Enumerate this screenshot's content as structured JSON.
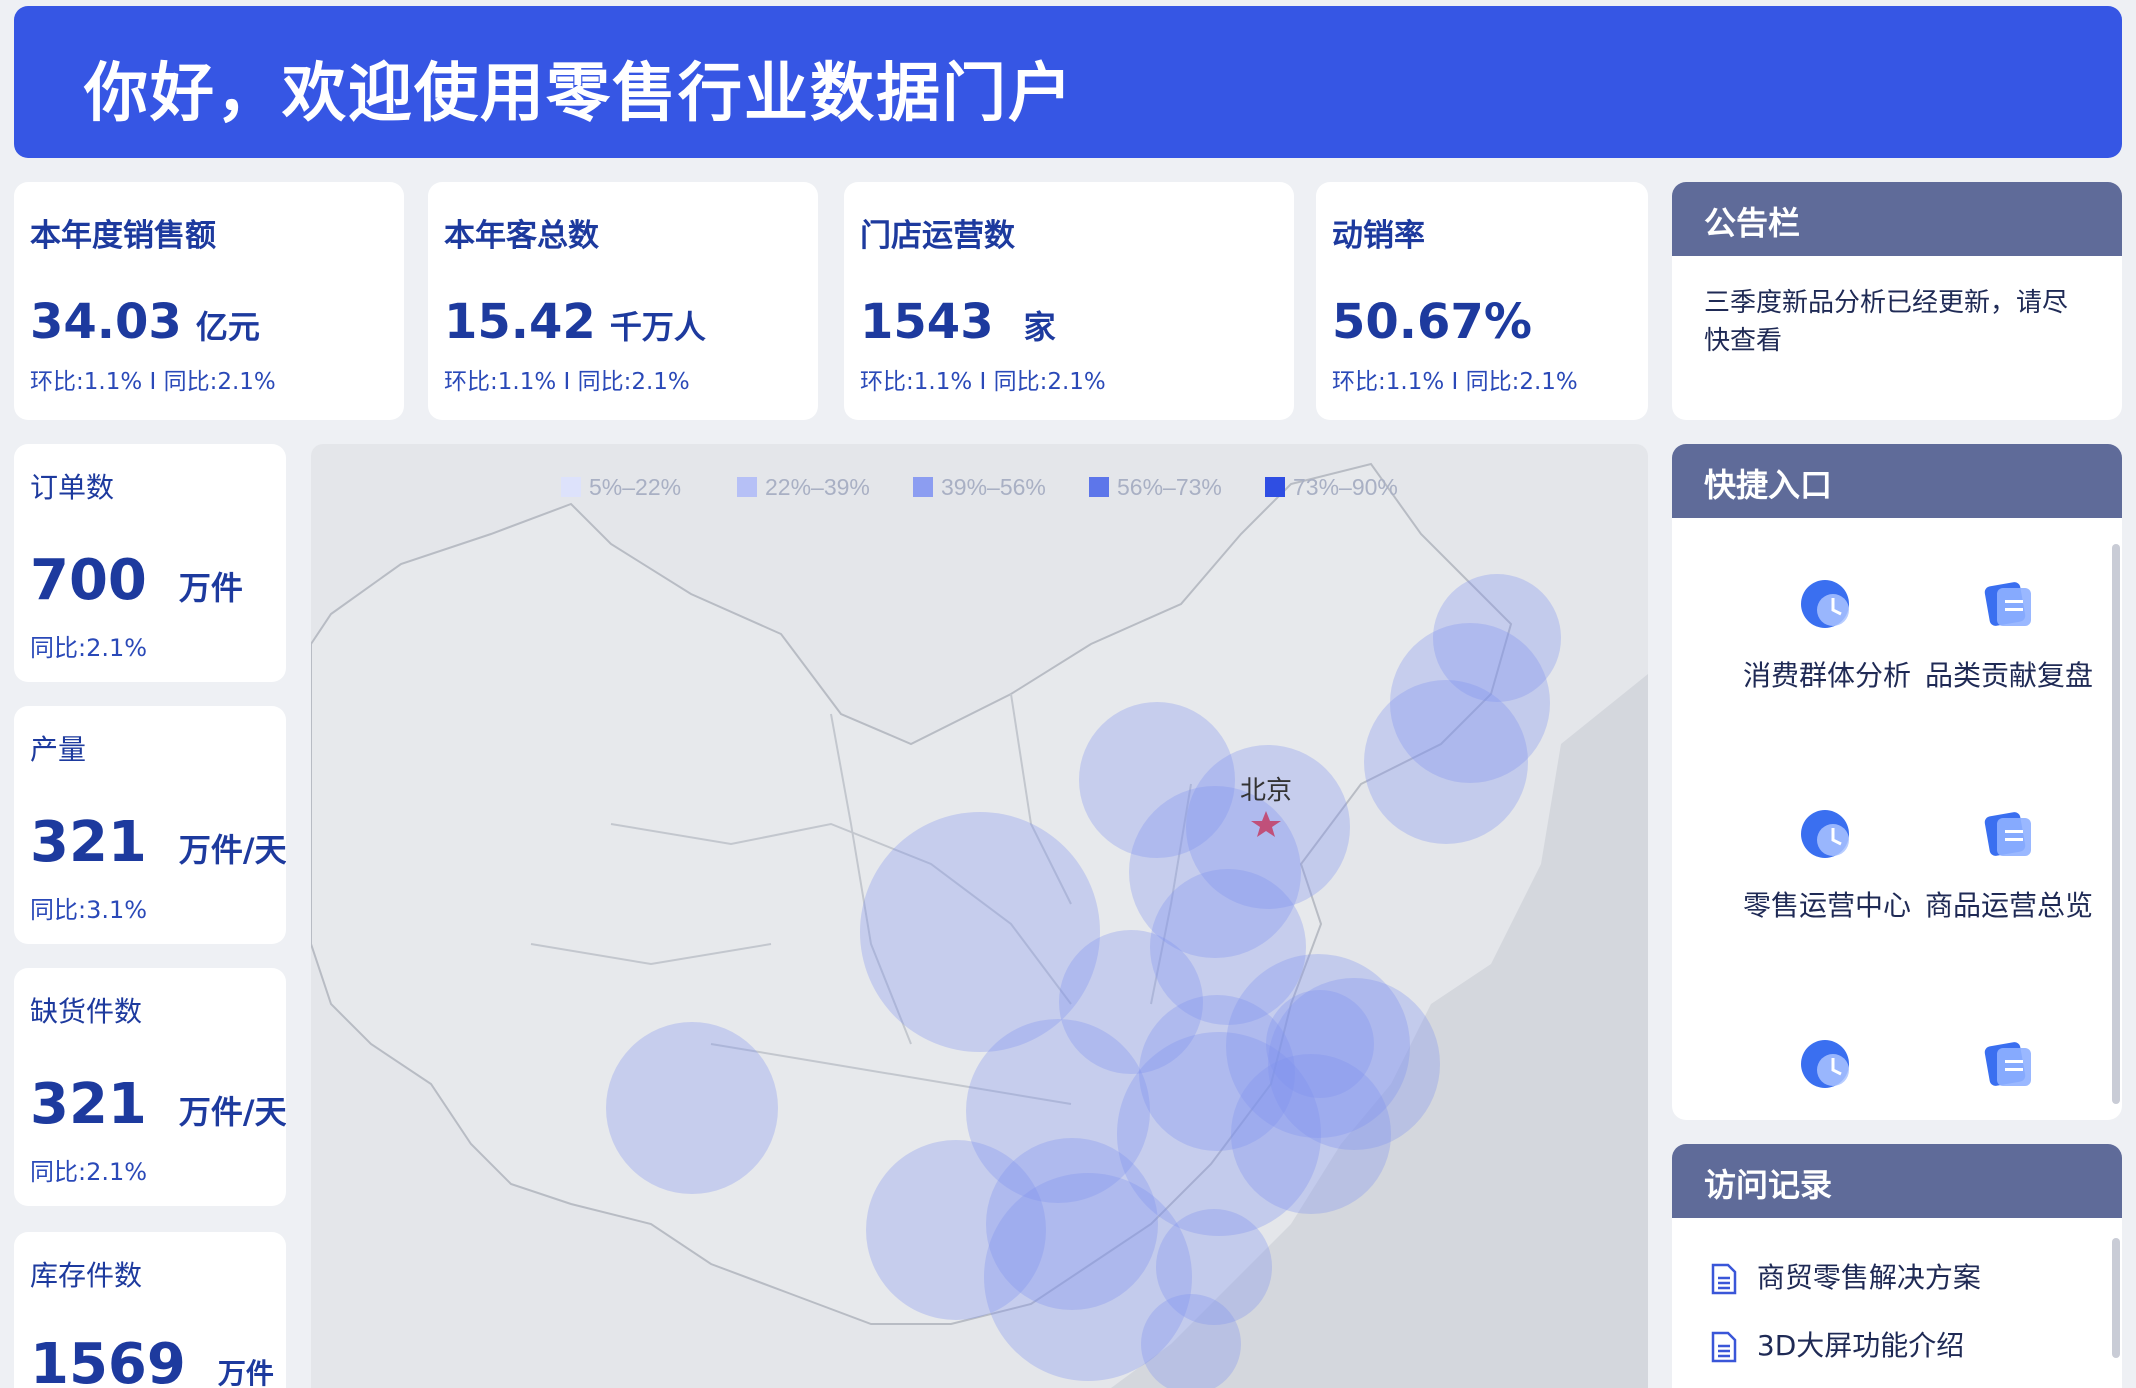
{
  "banner": {
    "title": "你好，欢迎使用零售行业数据门户"
  },
  "kpis": [
    {
      "title": "本年度销售额",
      "value": "34.03",
      "unit": "亿元",
      "sub": "环比:1.1% I 同比:2.1%"
    },
    {
      "title": "本年客总数",
      "value": "15.42",
      "unit": "千万人",
      "sub": "环比:1.1% I 同比:2.1%"
    },
    {
      "title": "门店运营数",
      "value": "1543",
      "unit": "家",
      "sub": "环比:1.1% I 同比:2.1%"
    },
    {
      "title": "动销率",
      "value": "50.67%",
      "unit": "",
      "sub": "环比:1.1% I 同比:2.1%"
    }
  ],
  "side_stats": [
    {
      "title": "订单数",
      "value": "700",
      "unit": "万件",
      "sub": "同比:2.1%"
    },
    {
      "title": "产量",
      "value": "321",
      "unit": "万件/天",
      "sub": "同比:3.1%"
    },
    {
      "title": "缺货件数",
      "value": "321",
      "unit": "万件/天",
      "sub": "同比:2.1%"
    },
    {
      "title": "库存件数",
      "value": "1569",
      "unit": "万件",
      "sub": ""
    }
  ],
  "map": {
    "city_label": "北京",
    "legend": [
      {
        "label": "5%–22%",
        "color": "#dde2fb"
      },
      {
        "label": "22%–39%",
        "color": "#b6c0f6"
      },
      {
        "label": "39%–56%",
        "color": "#8c9df1"
      },
      {
        "label": "56%–73%",
        "color": "#5d76ea"
      },
      {
        "label": "73%–90%",
        "color": "#2f4ee3"
      }
    ]
  },
  "notice": {
    "title": "公告栏",
    "text": "三季度新品分析已经更新，请尽快查看"
  },
  "quick": {
    "title": "快捷入口",
    "items": [
      {
        "label": "消费群体分析",
        "icon": "clock-chart-icon"
      },
      {
        "label": "品类贡献复盘",
        "icon": "document-stack-icon"
      },
      {
        "label": "零售运营中心",
        "icon": "clock-chart-icon"
      },
      {
        "label": "商品运营总览",
        "icon": "document-stack-icon"
      },
      {
        "label": "",
        "icon": "clock-chart-icon"
      },
      {
        "label": "",
        "icon": "document-stack-icon"
      }
    ]
  },
  "visits": {
    "title": "访问记录",
    "items": [
      {
        "label": "商贸零售解决方案",
        "icon": "document-icon"
      },
      {
        "label": "3D大屏功能介绍",
        "icon": "document-icon"
      }
    ]
  },
  "colors": {
    "brand": "#3656e4",
    "panel_header": "#5f6b99",
    "bubble": "#8093ee"
  }
}
